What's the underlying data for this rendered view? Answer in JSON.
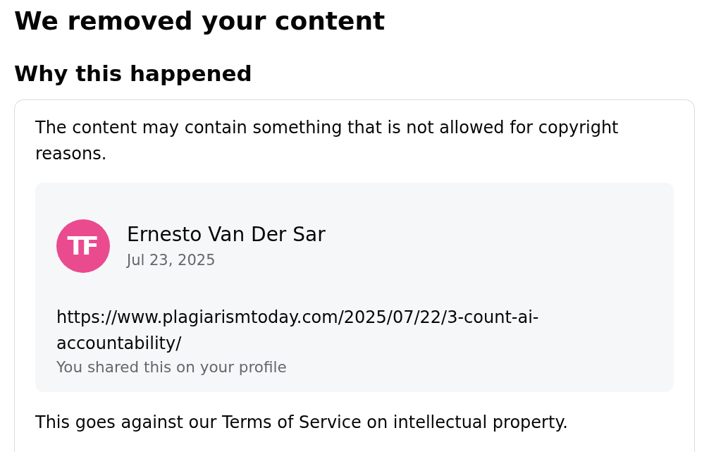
{
  "page": {
    "title": "We removed your content"
  },
  "section": {
    "heading": "Why this happened",
    "reason": "The content may contain something that is not allowed for copyright reasons.",
    "post": {
      "avatar_text": "TF",
      "author": "Ernesto Van Der Sar",
      "date": "Jul 23, 2025",
      "link": "https://www.plagiarismtoday.com/2025/07/22/3-count-ai-accountability/",
      "note": "You shared this on your profile"
    },
    "policy": "This goes against our Terms of Service on intellectual property."
  }
}
